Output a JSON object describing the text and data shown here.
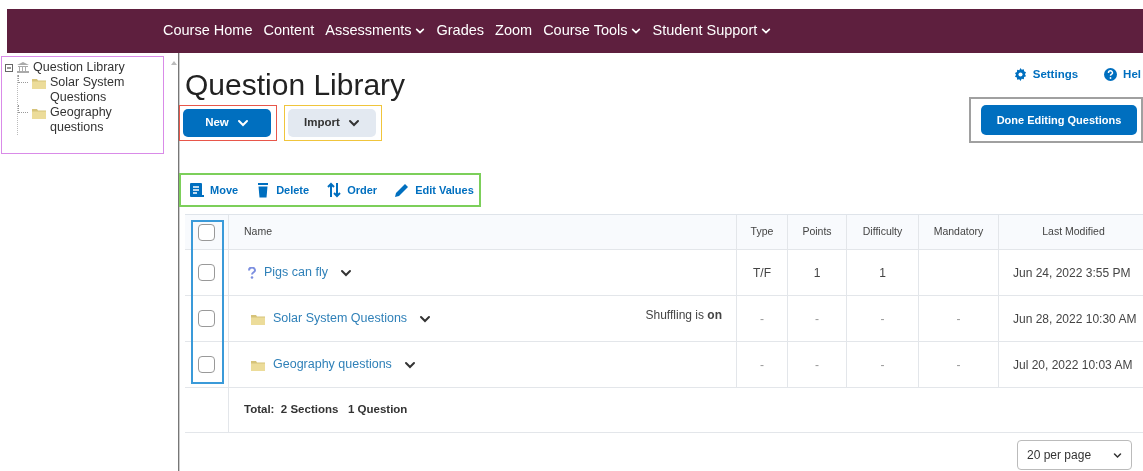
{
  "nav": {
    "items": [
      {
        "label": "Course Home",
        "dropdown": false
      },
      {
        "label": "Content",
        "dropdown": false
      },
      {
        "label": "Assessments",
        "dropdown": true
      },
      {
        "label": "Grades",
        "dropdown": false
      },
      {
        "label": "Zoom",
        "dropdown": false
      },
      {
        "label": "Course Tools",
        "dropdown": true
      },
      {
        "label": "Student Support",
        "dropdown": true
      }
    ]
  },
  "sidebar": {
    "color": "#d98be8",
    "tree": [
      {
        "label": "Question Library",
        "expanded": true,
        "children": [
          {
            "label": "Solar System Questions"
          },
          {
            "label": "Geography questions"
          }
        ]
      }
    ]
  },
  "page": {
    "title": "Question Library",
    "links": [
      {
        "kind": "settings",
        "label": "Settings"
      },
      {
        "kind": "help",
        "label": "Hel"
      }
    ]
  },
  "buttons": [
    {
      "label": "New",
      "kind": "primary",
      "color": "#e8564a"
    },
    {
      "label": "Import",
      "kind": "secondary",
      "color": "#f0c53c"
    }
  ],
  "done_button": {
    "label": "Done Editing Questions",
    "color": "#a0a0a0"
  },
  "toolbar": {
    "color": "#7ccf5a",
    "actions": [
      {
        "kind": "move",
        "label": "Move"
      },
      {
        "kind": "delete",
        "label": "Delete"
      },
      {
        "kind": "order",
        "label": "Order"
      },
      {
        "kind": "edit",
        "label": "Edit Values"
      }
    ]
  },
  "table": {
    "color": "#3a9ad9",
    "header_checked": false,
    "columns": [
      "Name",
      "Type",
      "Points",
      "Difficulty",
      "Mandatory",
      "Last Modified"
    ],
    "rows": [
      {
        "kind": "question",
        "checked": false,
        "name": "Pigs can fly",
        "type": "T/F",
        "points": "1",
        "difficulty": "1",
        "last_modified": "Jun 24, 2022 3:55 PM"
      },
      {
        "kind": "section",
        "checked": false,
        "name": "Solar System Questions",
        "note": "Shuffling is **on**",
        "type": "-",
        "points": "-",
        "difficulty": "-",
        "mandatory": "-",
        "last_modified": "Jun 28, 2022 10:30 AM"
      },
      {
        "kind": "section",
        "checked": false,
        "name": "Geography questions",
        "type": "-",
        "points": "-",
        "difficulty": "-",
        "mandatory": "-",
        "last_modified": "Jul 20, 2022 10:03 AM"
      }
    ],
    "total": "Total:  2 Sections   1 Question"
  },
  "pagination": {
    "per_page": "20 per page"
  }
}
